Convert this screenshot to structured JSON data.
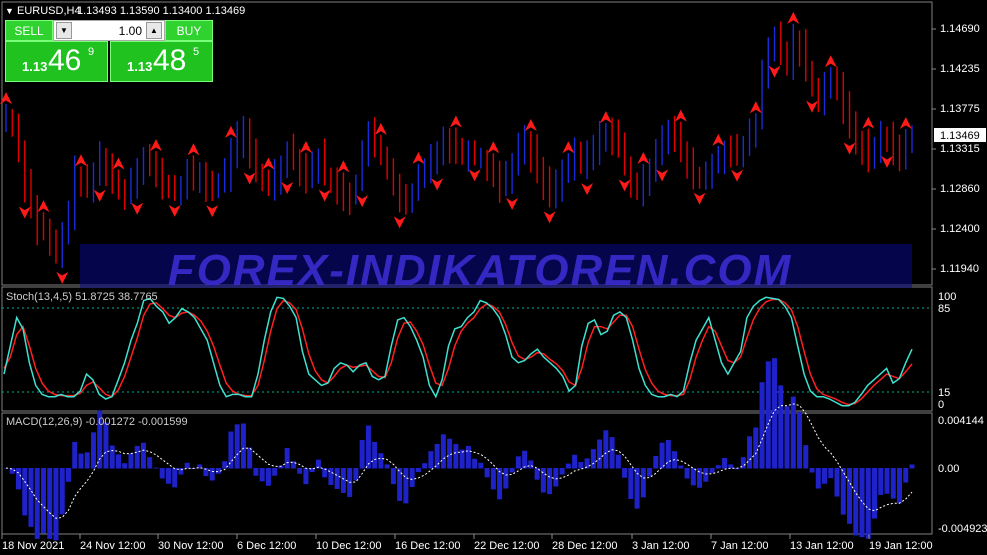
{
  "header": {
    "symbol": "EURUSD,H4",
    "ohlc": "1.13493 1.13590 1.13400 1.13469"
  },
  "trade_panel": {
    "sell_label": "SELL",
    "buy_label": "BUY",
    "lot_value": "1.00",
    "sell_prefix": "1.13",
    "sell_big": "46",
    "sell_sup": "9",
    "buy_prefix": "1.13",
    "buy_big": "48",
    "buy_sup": "5"
  },
  "watermark": "FOREX-INDIKATOREN.COM",
  "price_axis": {
    "labels": [
      "1.14690",
      "1.14235",
      "1.13775",
      "1.13315",
      "1.12860",
      "1.12400",
      "1.11940"
    ],
    "current_price": "1.13469"
  },
  "stoch": {
    "title": "Stoch(13,4,5) 51.8725 38.7765",
    "levels": [
      "100",
      "85",
      "15",
      "0"
    ]
  },
  "macd": {
    "title": "MACD(12,26,9) -0.001272 -0.001599",
    "levels": [
      "0.004144",
      "0.00",
      "-0.004923"
    ]
  },
  "time_axis": [
    "18 Nov 2021",
    "24 Nov 12:00",
    "30 Nov 12:00",
    "6 Dec 12:00",
    "10 Dec 12:00",
    "16 Dec 12:00",
    "22 Dec 12:00",
    "28 Dec 12:00",
    "3 Jan 12:00",
    "7 Jan 12:00",
    "13 Jan 12:00",
    "19 Jan 12:00"
  ],
  "colors": {
    "background": "#000000",
    "grid": "#404040",
    "up_candle": "#1a2bd8",
    "down_candle": "#e00000",
    "arrow": "#ff1a1a",
    "stoch_main": "#40e0d0",
    "stoch_signal": "#ff2020",
    "level_line": "#00b090",
    "macd_hist": "#1e22c8",
    "macd_signal": "#ffffff",
    "panel_green": "#1fc21f",
    "watermark": "#3a2cd0"
  },
  "chart_data": {
    "type": "candlestick",
    "price": [
      1.1365,
      1.1355,
      1.133,
      1.129,
      1.1265,
      1.124,
      1.1235,
      1.122,
      1.121,
      1.123,
      1.126,
      1.13,
      1.129,
      1.1285,
      1.13,
      1.132,
      1.131,
      1.129,
      1.1285,
      1.128,
      1.1295,
      1.131,
      1.132,
      1.131,
      1.13,
      1.129,
      1.1285,
      1.128,
      1.129,
      1.13,
      1.1295,
      1.13,
      1.129,
      1.1285,
      1.129,
      1.13,
      1.133,
      1.134,
      1.1345,
      1.1325,
      1.13,
      1.1295,
      1.129,
      1.13,
      1.131,
      1.133,
      1.132,
      1.131,
      1.13,
      1.131,
      1.132,
      1.13,
      1.129,
      1.1285,
      1.128,
      1.1275,
      1.129,
      1.133,
      1.1345,
      1.133,
      1.132,
      1.131,
      1.129,
      1.127,
      1.1265,
      1.128,
      1.1295,
      1.1305,
      1.132,
      1.133,
      1.134,
      1.1335,
      1.133,
      1.1325,
      1.133,
      1.132,
      1.132,
      1.131,
      1.13,
      1.129,
      1.13,
      1.1315,
      1.133,
      1.1335,
      1.1325,
      1.1305,
      1.129,
      1.1285,
      1.129,
      1.13,
      1.131,
      1.132,
      1.1315,
      1.132,
      1.133,
      1.134,
      1.135,
      1.1345,
      1.133,
      1.131,
      1.129,
      1.128,
      1.129,
      1.131,
      1.133,
      1.1345,
      1.135,
      1.134,
      1.1325,
      1.131,
      1.13,
      1.1295,
      1.13,
      1.131,
      1.132,
      1.133,
      1.1325,
      1.132,
      1.133,
      1.135,
      1.136,
      1.141,
      1.144,
      1.1455,
      1.144,
      1.143,
      1.145,
      1.1445,
      1.142,
      1.14,
      1.139,
      1.14,
      1.141,
      1.1395,
      1.1375,
      1.136,
      1.134,
      1.133,
      1.132,
      1.133,
      1.1345,
      1.134,
      1.133,
      1.132,
      1.1335,
      1.1347
    ],
    "stoch_main": [
      30,
      55,
      80,
      70,
      40,
      20,
      12,
      10,
      10,
      12,
      10,
      10,
      15,
      30,
      25,
      12,
      8,
      10,
      25,
      40,
      60,
      75,
      95,
      97,
      90,
      85,
      75,
      80,
      88,
      85,
      80,
      70,
      60,
      40,
      20,
      10,
      12,
      12,
      10,
      10,
      30,
      60,
      85,
      98,
      97,
      90,
      80,
      50,
      30,
      25,
      20,
      22,
      35,
      40,
      38,
      32,
      38,
      40,
      28,
      25,
      28,
      55,
      78,
      80,
      72,
      60,
      45,
      20,
      10,
      25,
      55,
      70,
      72,
      80,
      85,
      95,
      93,
      88,
      80,
      65,
      45,
      40,
      42,
      48,
      52,
      45,
      40,
      35,
      28,
      15,
      20,
      55,
      75,
      78,
      65,
      68,
      82,
      85,
      80,
      60,
      35,
      20,
      12,
      10,
      10,
      12,
      10,
      15,
      40,
      60,
      70,
      80,
      60,
      40,
      30,
      40,
      50,
      80,
      90,
      95,
      98,
      97,
      96,
      90,
      80,
      55,
      30,
      15,
      10,
      10,
      8,
      5,
      2,
      2,
      5,
      12,
      20,
      25,
      30,
      35,
      22,
      26,
      40,
      52
    ],
    "stoch_signal": [
      35,
      45,
      65,
      72,
      55,
      35,
      22,
      15,
      12,
      11,
      11,
      11,
      13,
      20,
      23,
      18,
      12,
      10,
      16,
      28,
      45,
      62,
      82,
      92,
      93,
      88,
      82,
      80,
      84,
      85,
      82,
      77,
      68,
      55,
      38,
      22,
      15,
      12,
      11,
      11,
      20,
      42,
      68,
      88,
      95,
      93,
      87,
      70,
      48,
      33,
      25,
      22,
      28,
      35,
      38,
      36,
      37,
      38,
      33,
      28,
      27,
      40,
      62,
      75,
      76,
      68,
      56,
      38,
      22,
      20,
      35,
      55,
      68,
      75,
      80,
      88,
      92,
      90,
      85,
      74,
      58,
      46,
      43,
      45,
      49,
      48,
      43,
      39,
      33,
      23,
      20,
      35,
      58,
      72,
      72,
      70,
      76,
      82,
      82,
      72,
      52,
      34,
      22,
      15,
      12,
      11,
      11,
      12,
      25,
      45,
      60,
      72,
      68,
      55,
      42,
      40,
      45,
      62,
      78,
      88,
      94,
      96,
      96,
      93,
      87,
      72,
      50,
      30,
      17,
      12,
      10,
      8,
      5,
      3,
      4,
      8,
      14,
      20,
      25,
      30,
      28,
      26,
      32,
      39
    ]
  }
}
